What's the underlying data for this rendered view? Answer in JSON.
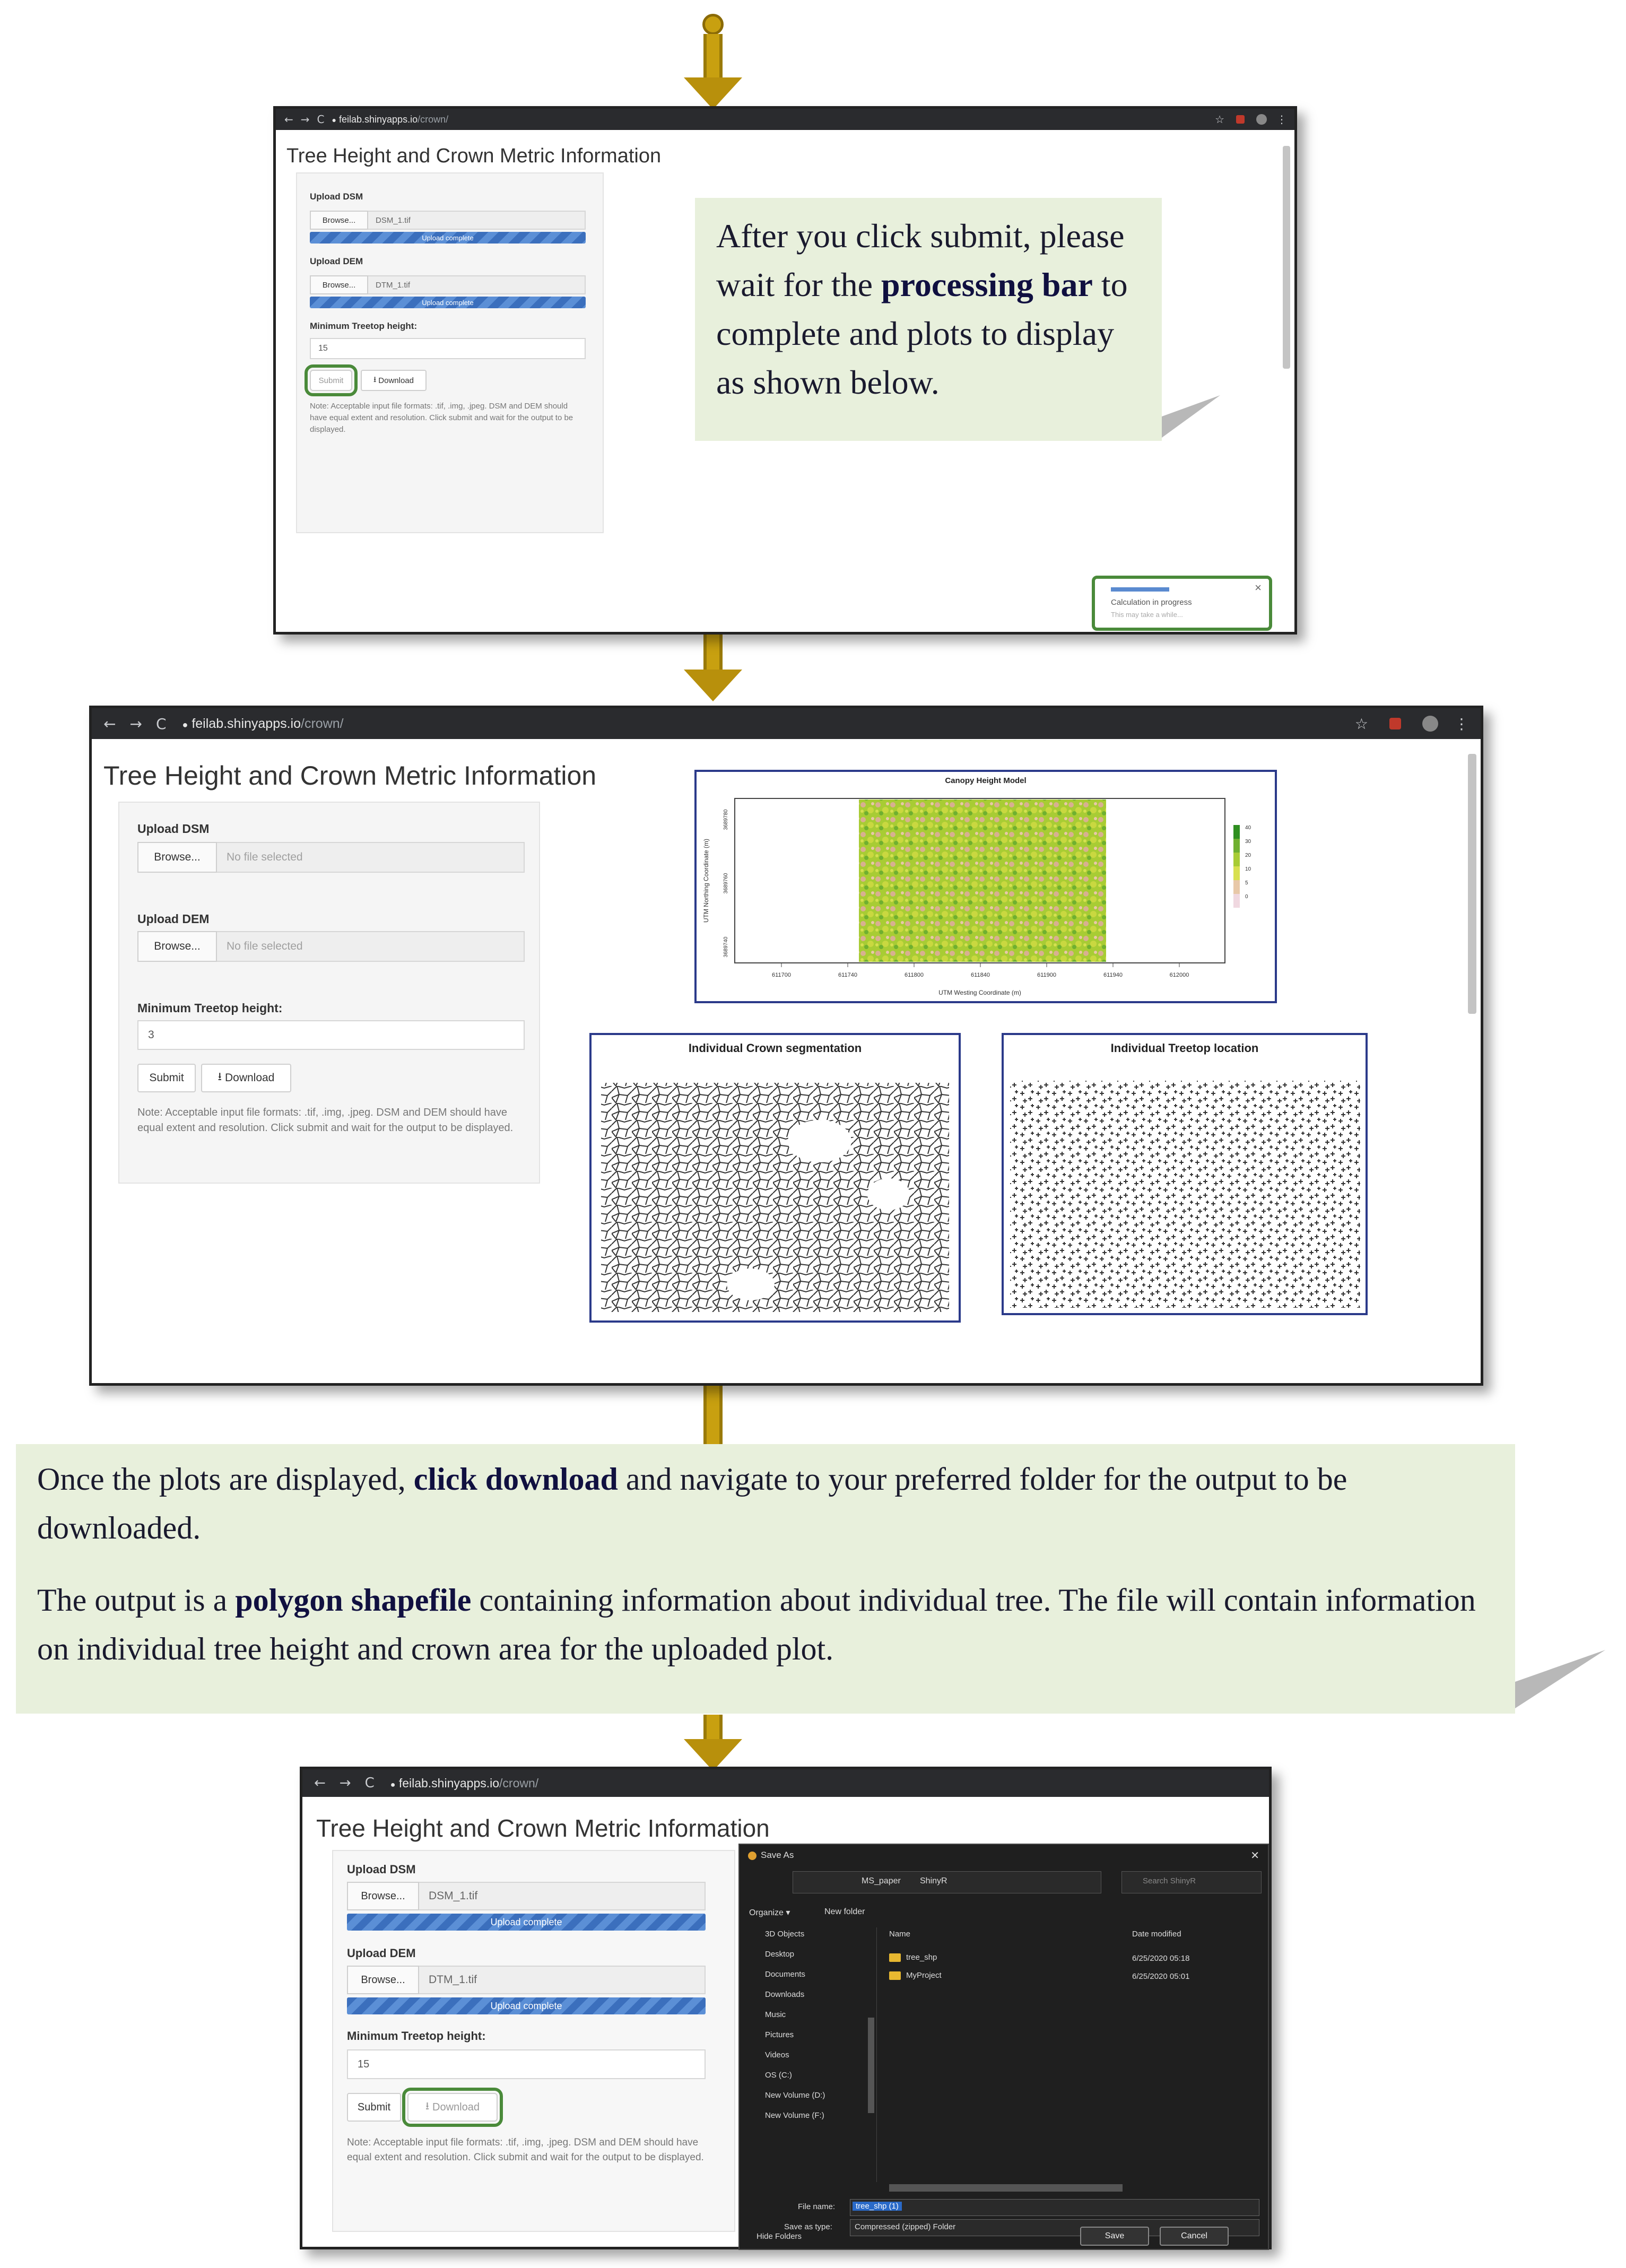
{
  "browser": {
    "url_host": "feilab.shinyapps.io",
    "url_path": "/crown/",
    "back": "←",
    "forward": "→",
    "reload": "C",
    "lock": "🔒",
    "star": "☆",
    "menu": "⋮"
  },
  "app": {
    "title": "Tree Height and Crown Metric Information",
    "upload_dsm_label": "Upload DSM",
    "upload_dem_label": "Upload DEM",
    "min_height_label": "Minimum Treetop height:",
    "browse_label": "Browse...",
    "submit_label": "Submit",
    "download_label": "Download",
    "download_icon": "⭳",
    "upload_complete": "Upload complete",
    "note": "Note: Acceptable input file formats: .tif, .img, .jpeg. DSM and DEM should have equal extent and resolution. Click submit and wait for the output to be displayed."
  },
  "screen1": {
    "dsm_file": "DSM_1.tif",
    "dem_file": "DTM_1.tif",
    "min_height": "15",
    "callout_parts": [
      "After you click submit, please wait for the ",
      "processing bar",
      " to complete and plots to display as shown below."
    ],
    "toast_text": "Calculation in progress",
    "toast_sub": "This may take a while...",
    "toast_close": "×"
  },
  "screen2": {
    "dsm_file": "No file selected",
    "dem_file": "No file selected",
    "min_height": "3",
    "chm_title": "Canopy Height Model",
    "chm_ylabel": "UTM Northing Coordinate (m)",
    "chm_xlabel": "UTM Westing Coordinate (m)",
    "chm_xticks": [
      "611700",
      "611740",
      "611800",
      "611840",
      "611900",
      "611940",
      "612000"
    ],
    "chm_yticks": [
      "3689780",
      "3689760",
      "3689740"
    ],
    "chm_legend_ticks": [
      "40",
      "30",
      "20",
      "10",
      "5",
      "0"
    ],
    "crown_title": "Individual Crown segmentation",
    "treetop_title": "Individual Treetop location"
  },
  "middle_callout": {
    "p1": [
      "Once the plots are displayed, ",
      "click download",
      " and navigate to your preferred folder for the output to be downloaded."
    ],
    "p2": [
      "The output is a ",
      "polygon shapefile",
      " containing information about individual tree. The file will contain information on individual tree height and crown area for the uploaded plot."
    ]
  },
  "screen3": {
    "dsm_file": "DSM_1.tif",
    "dem_file": "DTM_1.tif",
    "min_height": "15",
    "dialog": {
      "title": "Save As",
      "close": "✕",
      "path": [
        "MS_paper",
        "ShinyR"
      ],
      "search_placeholder": "Search ShinyR",
      "organize": "Organize ▾",
      "new_folder": "New folder",
      "sidebar": [
        "3D Objects",
        "Desktop",
        "Documents",
        "Downloads",
        "Music",
        "Pictures",
        "Videos",
        "OS (C:)",
        "New Volume (D:)",
        "New Volume (F:)"
      ],
      "col_name": "Name",
      "col_date": "Date modified",
      "files": [
        {
          "name": "tree_shp",
          "date": "6/25/2020 05:18"
        },
        {
          "name": "MyProject",
          "date": "6/25/2020 05:01"
        }
      ],
      "file_name_label": "File name:",
      "file_name_value": "tree_shp (1)",
      "save_type_label": "Save as type:",
      "save_type_value": "Compressed (zipped) Folder",
      "hide_folders": "Hide Folders",
      "save": "Save",
      "cancel": "Cancel"
    }
  },
  "colors": {
    "arrow": "#c8a010",
    "callout_bg": "#e8f0dc",
    "highlight": "#4a8a3a",
    "plot_frame": "#2b3a8a",
    "progress": "#3b6fbd"
  }
}
